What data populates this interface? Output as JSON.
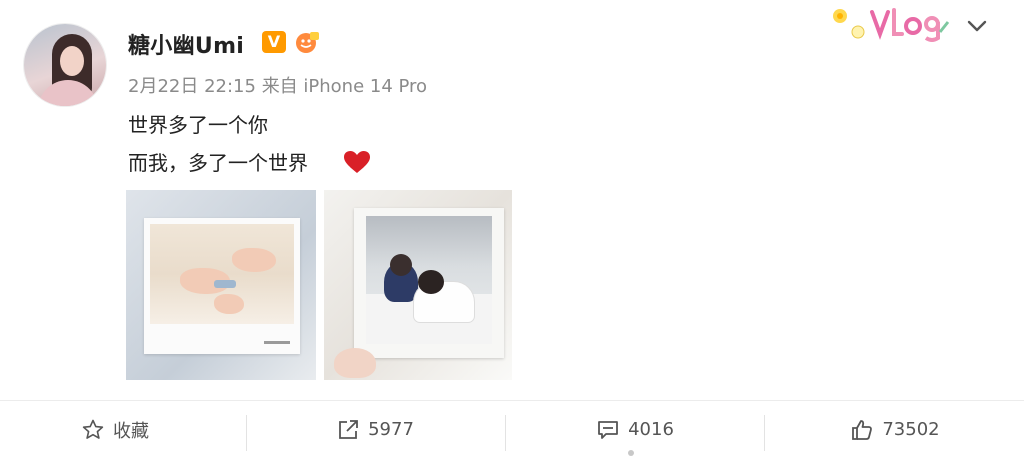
{
  "post": {
    "username": "糖小幽Umi",
    "verified_badge": "V",
    "timestamp": "2月22日 22:15",
    "source": "来自 iPhone 14 Pro",
    "lines": [
      "世界多了一个你",
      "而我，多了一个世界"
    ]
  },
  "actions": {
    "favorite_label": "收藏",
    "repost_count": "5977",
    "comment_count": "4016",
    "like_count": "73502"
  },
  "icons": {
    "verified": "verified-v-badge",
    "level": "level-badge",
    "heart": "heart-emoji",
    "vlog": "vlog-sticker",
    "chevron": "chevron-down-icon",
    "star": "star-icon",
    "repost": "repost-icon",
    "comment": "comment-icon",
    "like": "thumbs-up-icon"
  },
  "colors": {
    "accent": "#ff9a00",
    "heart": "#d92027"
  }
}
